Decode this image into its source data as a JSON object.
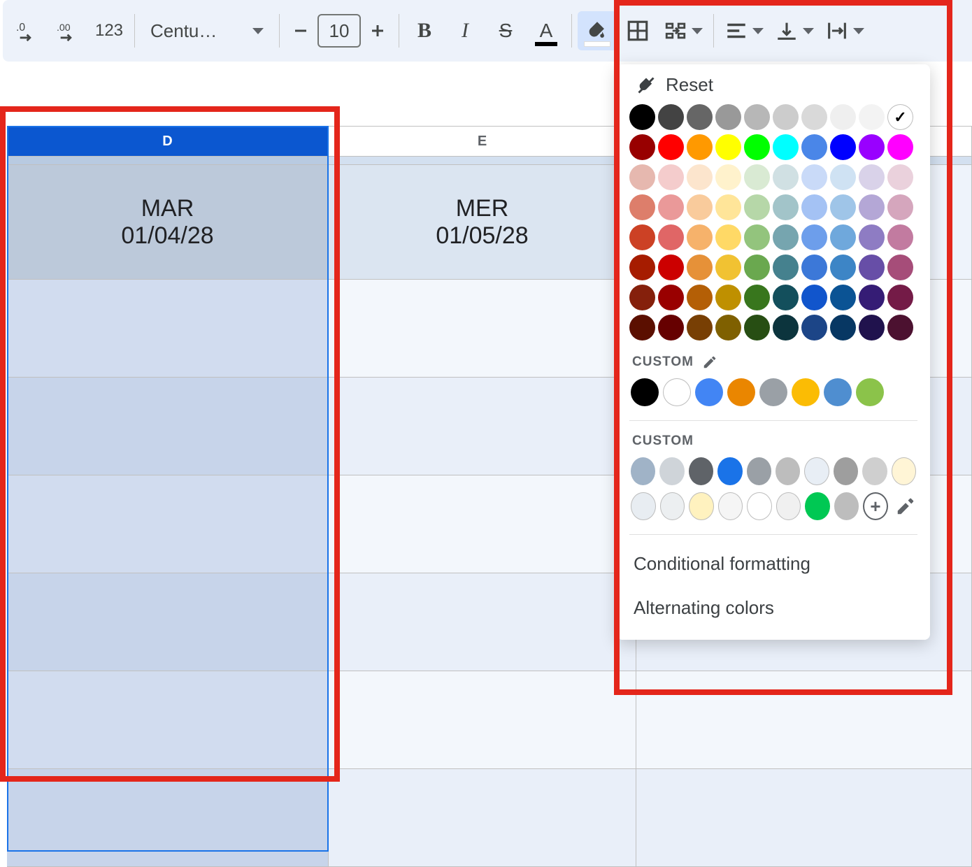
{
  "toolbar": {
    "decimal_dec_icon": ".0",
    "decimal_inc_icon": ".00",
    "format_as_number": "123",
    "font_name": "Centu…",
    "font_size": "10",
    "bold_glyph": "B",
    "italic_glyph": "I",
    "strike_glyph": "S",
    "textcolor_glyph": "A"
  },
  "columns": {
    "D": "D",
    "E": "E"
  },
  "headers": {
    "D": {
      "day": "MAR",
      "date": "01/04/28"
    },
    "E": {
      "day": "MER",
      "date": "01/05/28"
    }
  },
  "picker": {
    "reset": "Reset",
    "custom_label_1": "CUSTOM",
    "custom_label_2": "CUSTOM",
    "conditional_formatting": "Conditional formatting",
    "alternating_colors": "Alternating colors",
    "palette": [
      [
        "#000000",
        "#434343",
        "#666666",
        "#999999",
        "#b7b7b7",
        "#cccccc",
        "#d9d9d9",
        "#efefef",
        "#f3f3f3",
        "#ffffff"
      ],
      [
        "#980000",
        "#ff0000",
        "#ff9900",
        "#ffff00",
        "#00ff00",
        "#00ffff",
        "#4a86e8",
        "#0000ff",
        "#9900ff",
        "#ff00ff"
      ],
      [
        "#e6b8af",
        "#f4cccc",
        "#fce5cd",
        "#fff2cc",
        "#d9ead3",
        "#d0e0e3",
        "#c9daf8",
        "#cfe2f3",
        "#d9d2e9",
        "#ead1dc"
      ],
      [
        "#dd7e6b",
        "#ea9999",
        "#f9cb9c",
        "#ffe599",
        "#b6d7a8",
        "#a2c4c9",
        "#a4c2f4",
        "#9fc5e8",
        "#b4a7d6",
        "#d5a6bd"
      ],
      [
        "#cc4125",
        "#e06666",
        "#f6b26b",
        "#ffd966",
        "#93c47d",
        "#76a5af",
        "#6d9eeb",
        "#6fa8dc",
        "#8e7cc3",
        "#c27ba0"
      ],
      [
        "#a61c00",
        "#cc0000",
        "#e69138",
        "#f1c232",
        "#6aa84f",
        "#45818e",
        "#3c78d8",
        "#3d85c6",
        "#674ea7",
        "#a64d79"
      ],
      [
        "#85200c",
        "#990000",
        "#b45f06",
        "#bf9000",
        "#38761d",
        "#134f5c",
        "#1155cc",
        "#0b5394",
        "#351c75",
        "#741b47"
      ],
      [
        "#5b0f00",
        "#660000",
        "#783f04",
        "#7f6000",
        "#274e13",
        "#0c343d",
        "#1c4587",
        "#073763",
        "#20124d",
        "#4c1130"
      ]
    ],
    "custom1": [
      "#000000",
      "#ffffff",
      "#4285f4",
      "#ea8600",
      "#9aa0a6",
      "#fbbc04",
      "#4f8ed0",
      "#8bc34a"
    ],
    "custom2_row1": [
      "#a0b3c7",
      "#cfd4d9",
      "#5f6368",
      "#1a73e8",
      "#9aa0a6",
      "#bdbdbd",
      "#e8eef5",
      "#9e9e9e",
      "#cfcfcf",
      "#fff5d6"
    ],
    "custom2_row2": [
      "#e8edf2",
      "#eceff1",
      "#fff2bf",
      "#f5f5f5",
      "#ffffff",
      "#f0f0f0",
      "#00c853",
      "#bdbdbd"
    ]
  }
}
